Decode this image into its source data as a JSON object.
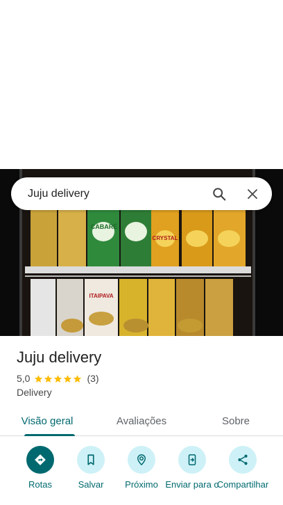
{
  "search": {
    "query": "Juju delivery"
  },
  "place": {
    "name": "Juju delivery",
    "rating": "5,0",
    "stars": 5,
    "review_count": "(3)",
    "category": "Delivery"
  },
  "tabs": [
    {
      "label": "Visão geral",
      "active": true
    },
    {
      "label": "Avaliações",
      "active": false
    },
    {
      "label": "Sobre",
      "active": false
    }
  ],
  "actions": [
    {
      "label": "Rotas",
      "icon": "directions-icon"
    },
    {
      "label": "Salvar",
      "icon": "bookmark-icon"
    },
    {
      "label": "Próximo",
      "icon": "nearby-icon"
    },
    {
      "label": "Enviar para o",
      "icon": "send-to-phone-icon"
    },
    {
      "label": "Compartilhar",
      "icon": "share-icon"
    }
  ],
  "photo_labels": {
    "green_can": "CABARÉ",
    "gold_can": "CRYSTAL",
    "red_can": "ITAIPAVA"
  },
  "colors": {
    "accent": "#00696f",
    "accent_light": "#cdf1f7",
    "star": "#fbbc04"
  }
}
